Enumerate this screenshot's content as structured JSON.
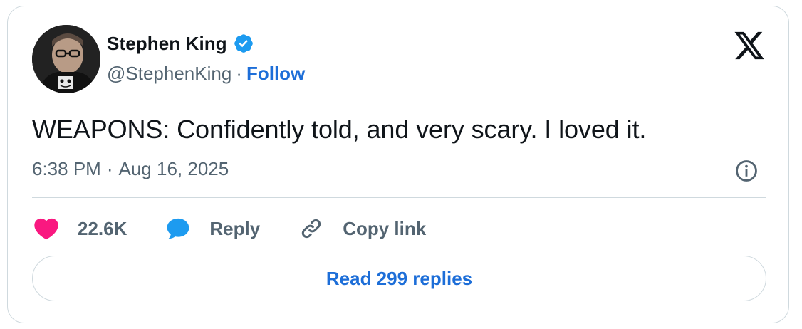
{
  "author": {
    "display_name": "Stephen King",
    "handle": "@StephenKing",
    "separator": "·",
    "follow_label": "Follow",
    "verified_color": "#1d9bf0"
  },
  "brand": {
    "logo_icon": "x-logo-icon"
  },
  "tweet": {
    "text": "WEAPONS: Confidently told, and very scary. I loved it.",
    "time": "6:38 PM",
    "separator": "·",
    "date": "Aug 16, 2025"
  },
  "actions": {
    "like_count": "22.6K",
    "like_color": "#f91880",
    "reply_label": "Reply",
    "reply_color": "#1d9bf0",
    "copy_label": "Copy link"
  },
  "footer": {
    "read_replies_label": "Read 299 replies"
  },
  "colors": {
    "link": "#1d6ed8",
    "secondary_text": "#536471",
    "border": "#cfd9de"
  }
}
